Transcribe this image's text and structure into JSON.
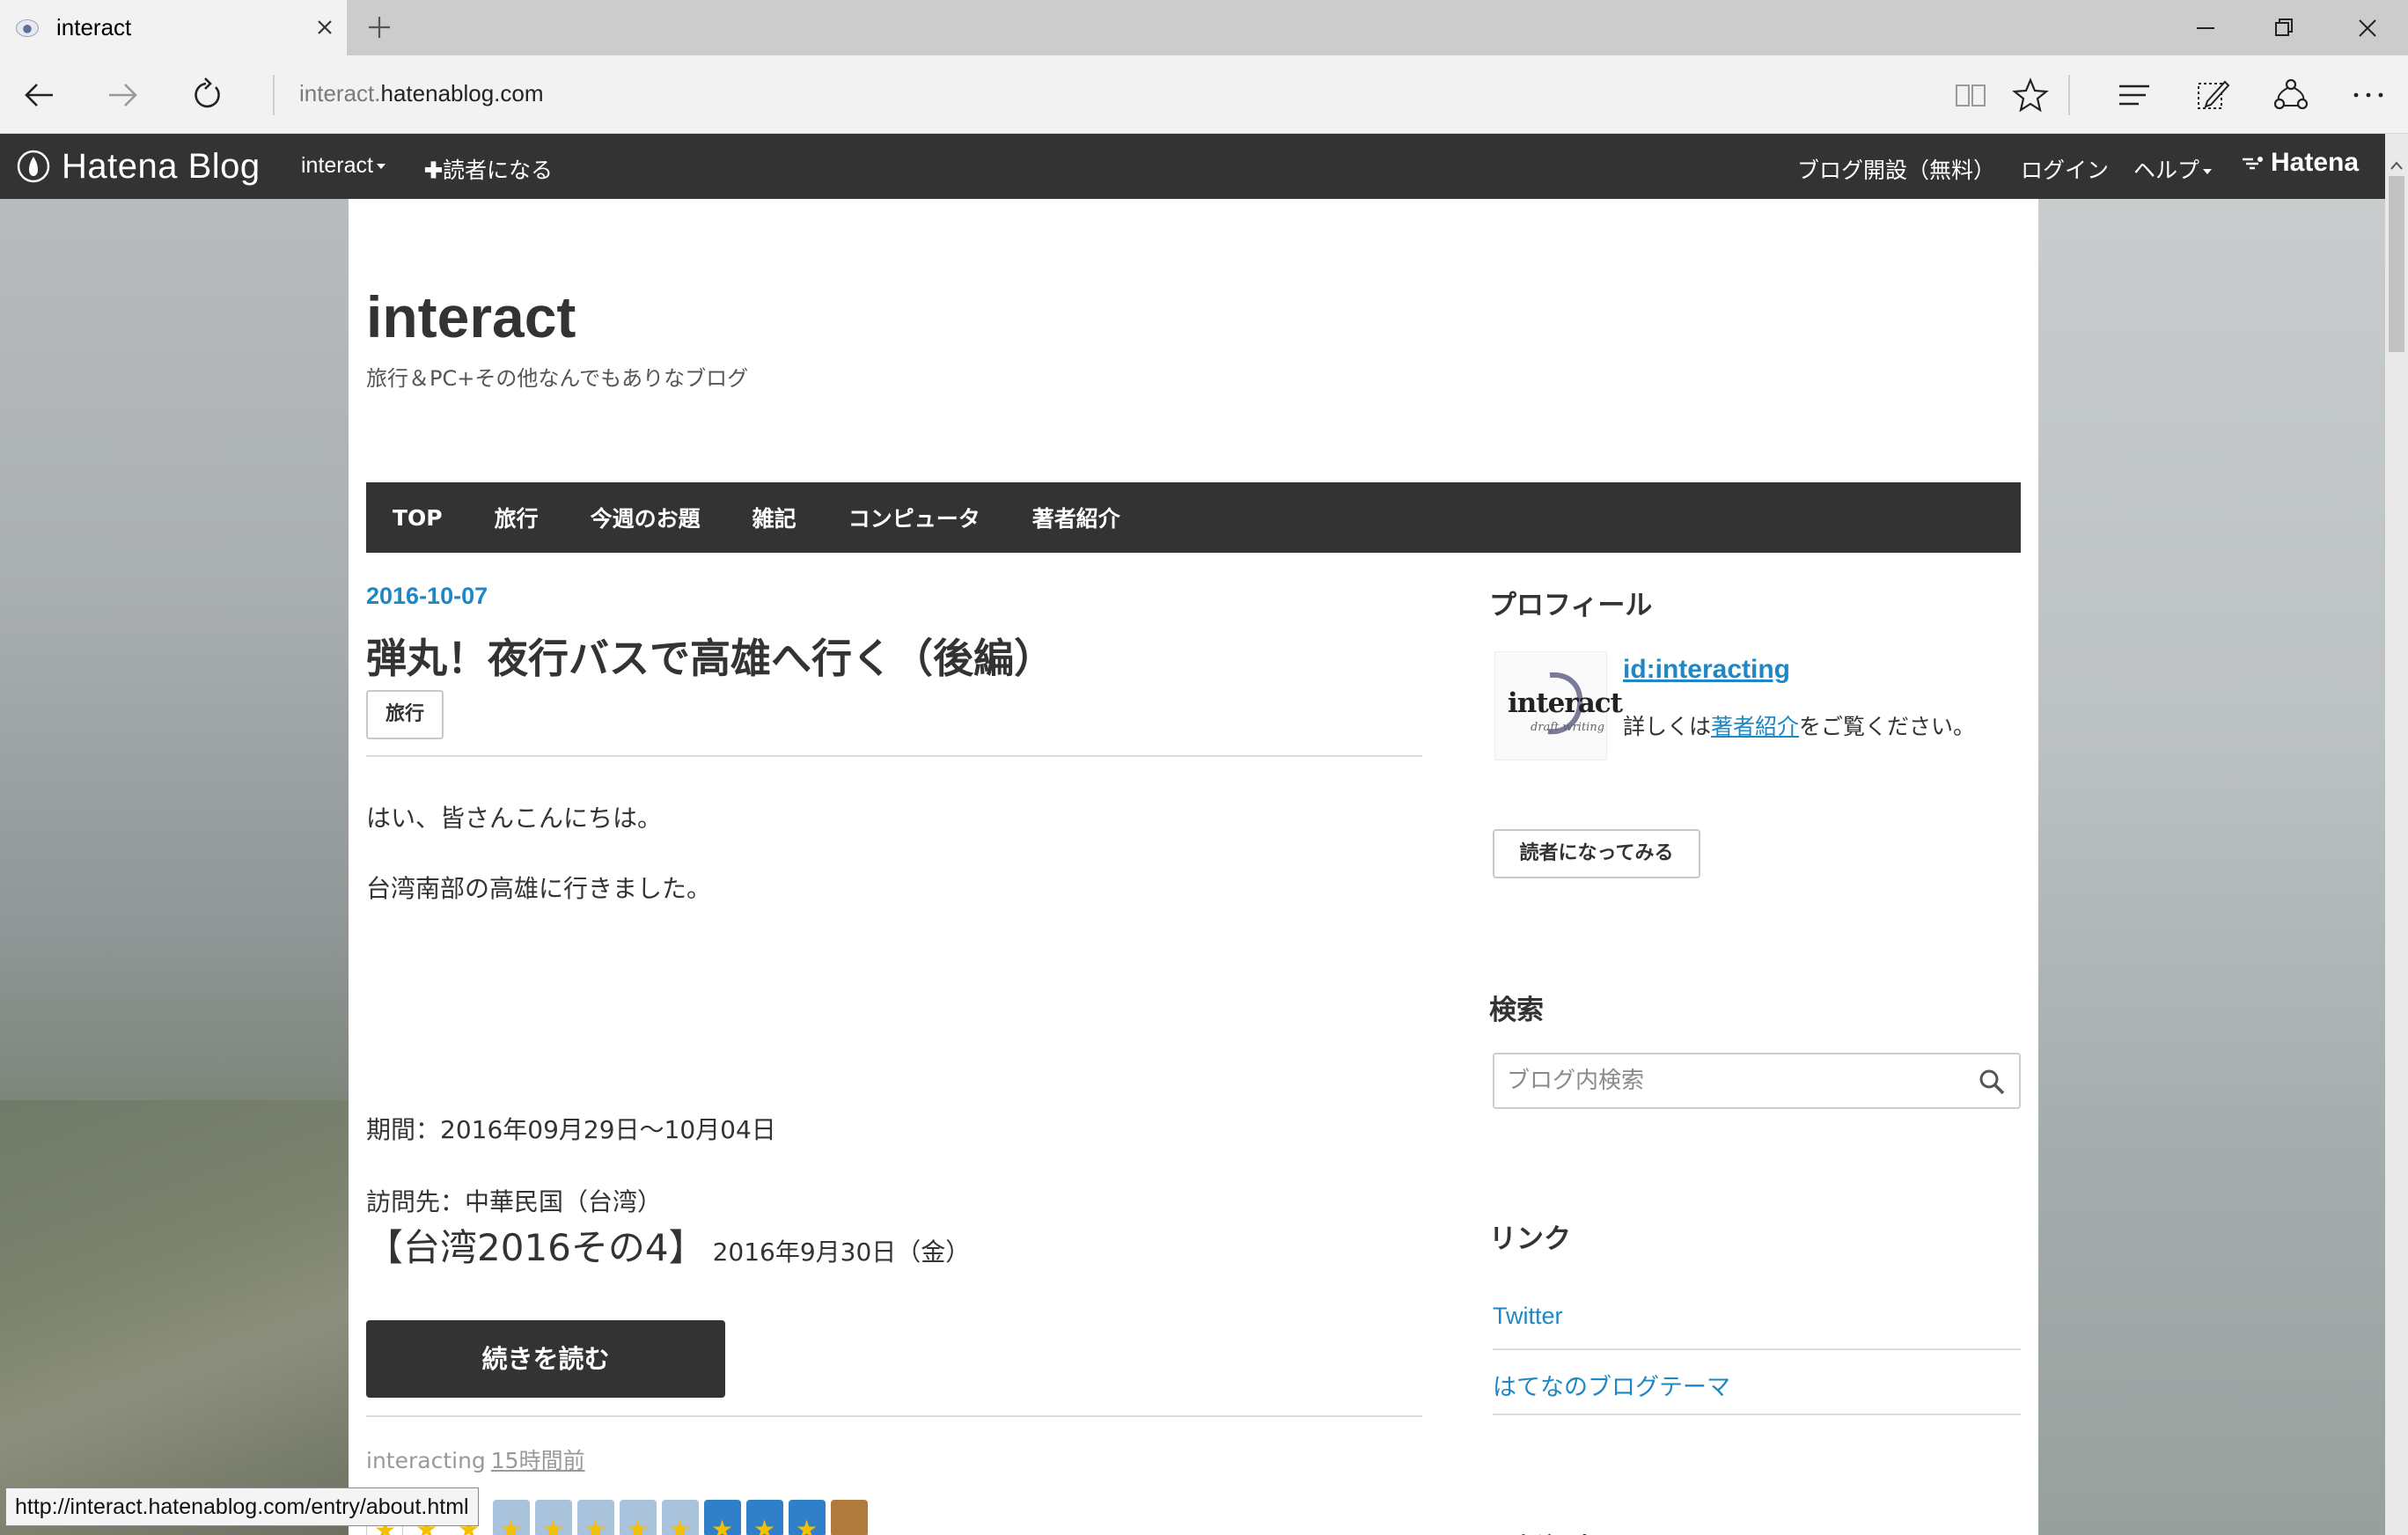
{
  "browser": {
    "tab_title": "interact",
    "address_prefix": "interact.",
    "address_host": "hatenablog.com"
  },
  "hatena_bar": {
    "logo_text": "Hatena Blog",
    "blog_menu": "interact",
    "subscribe": "読者になる",
    "start_blog": "ブログ開設（無料）",
    "login": "ログイン",
    "help": "ヘルプ",
    "hatena": "Hatena"
  },
  "blog": {
    "title": "interact",
    "description": "旅行＆PC+その他なんでもありなブログ"
  },
  "global_nav": [
    "TOP",
    "旅行",
    "今週のお題",
    "雑記",
    "コンピュータ",
    "著者紹介"
  ],
  "entry": {
    "date": "2016-10-07",
    "title": "弾丸！夜行バスで高雄へ行く（後編）",
    "category": "旅行",
    "p1": "はい、皆さんこんにちは。",
    "p2": "台湾南部の高雄に行きました。",
    "heading_main": "【台湾2016その4】",
    "heading_sub": "2016年9月30日（金）",
    "period": "期間：2016年09月29日〜10月04日",
    "destination": "訪問先：中華民国（台湾）",
    "read_more": "続きを読む",
    "author": "interacting",
    "time_ago": "15時間前"
  },
  "sidebar": {
    "profile_title": "プロフィール",
    "profile_icon_text": "interact",
    "profile_icon_sub": "draft writing",
    "profile_id": "id:interacting",
    "profile_desc_pre": "詳しくは",
    "profile_desc_link": "著者紹介",
    "profile_desc_post": "をご覧ください。",
    "subscribe_button": "読者になってみる",
    "search_title": "検索",
    "search_placeholder": "ブログ内検索",
    "links_title": "リンク",
    "links": [
      "Twitter",
      "はてなのブログテーマ"
    ],
    "recent_title": "最新記事"
  },
  "status_url": "http://interact.hatenablog.com/entry/about.html",
  "colors": {
    "accent_link": "#1f87c3",
    "header_bg": "#333333",
    "star": "#f3c000"
  }
}
